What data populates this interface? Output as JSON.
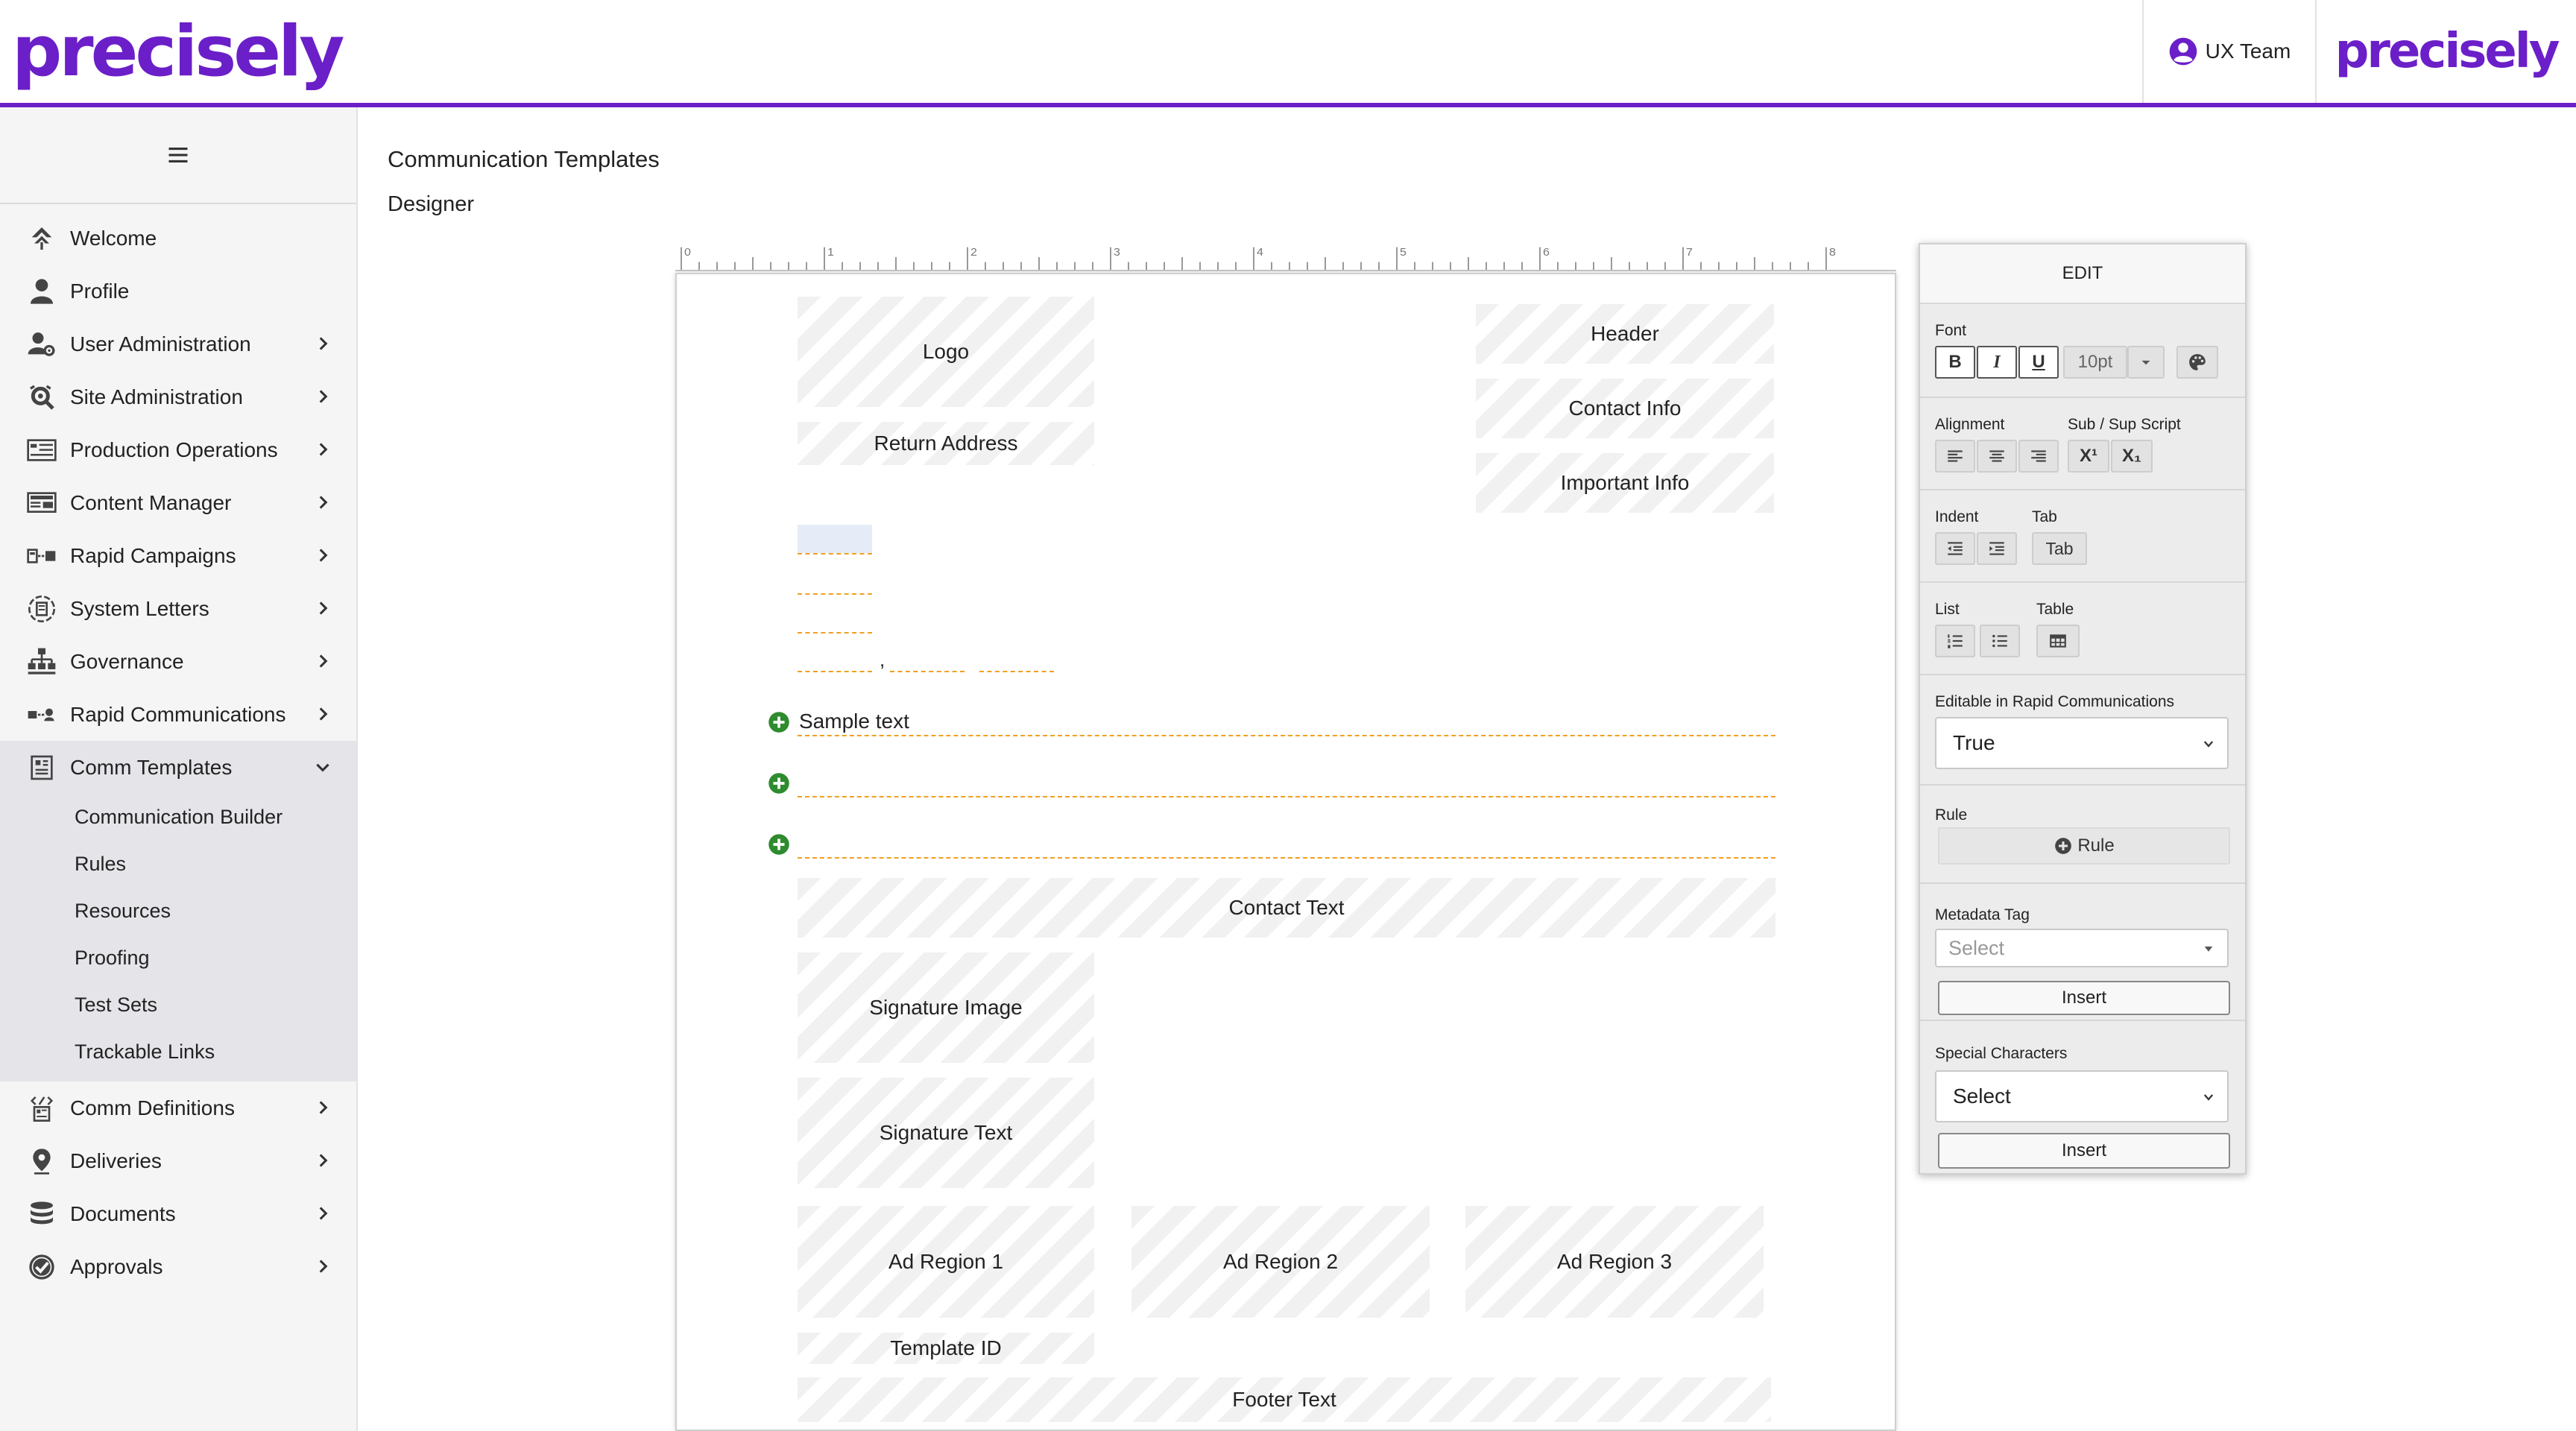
{
  "brand": {
    "name": "precisely",
    "logo_text": "precisely"
  },
  "header": {
    "user_label": "UX Team"
  },
  "sidebar": {
    "items": [
      {
        "label": "Welcome",
        "icon": "compass-icon",
        "chevron": false
      },
      {
        "label": "Profile",
        "icon": "person-icon",
        "chevron": false
      },
      {
        "label": "User Administration",
        "icon": "user-admin-icon",
        "chevron": true
      },
      {
        "label": "Site Administration",
        "icon": "site-gear-icon",
        "chevron": true
      },
      {
        "label": "Production Operations",
        "icon": "production-icon",
        "chevron": true
      },
      {
        "label": "Content Manager",
        "icon": "content-icon",
        "chevron": true
      },
      {
        "label": "Rapid Campaigns",
        "icon": "campaign-icon",
        "chevron": true
      },
      {
        "label": "System Letters",
        "icon": "letters-icon",
        "chevron": true
      },
      {
        "label": "Governance",
        "icon": "hierarchy-icon",
        "chevron": true
      },
      {
        "label": "Rapid Communications",
        "icon": "rapid-comm-icon",
        "chevron": true
      },
      {
        "label": "Comm Templates",
        "icon": "templates-icon",
        "chevron": true,
        "expanded": true
      }
    ],
    "sub_items": [
      "Communication Builder",
      "Rules",
      "Resources",
      "Proofing",
      "Test Sets",
      "Trackable Links"
    ],
    "items_after": [
      {
        "label": "Comm Definitions",
        "icon": "definitions-icon"
      },
      {
        "label": "Deliveries",
        "icon": "location-pin-icon"
      },
      {
        "label": "Documents",
        "icon": "stack-icon"
      },
      {
        "label": "Approvals",
        "icon": "check-badge-icon"
      }
    ]
  },
  "main": {
    "title": "Communication Templates",
    "subtitle": "Designer",
    "ruler_labels": [
      "0",
      "1",
      "2",
      "3",
      "4",
      "5",
      "6",
      "7",
      "8"
    ]
  },
  "canvas": {
    "logo": "Logo",
    "header": "Header",
    "return_address": "Return Address",
    "contact_info": "Contact Info",
    "important_info": "Important Info",
    "address_comma": ",",
    "sample_text": "Sample text",
    "contact_text": "Contact Text",
    "signature_image": "Signature Image",
    "signature_text": "Signature Text",
    "ad_region_1": "Ad Region 1",
    "ad_region_2": "Ad Region 2",
    "ad_region_3": "Ad Region 3",
    "template_id": "Template ID",
    "footer_text": "Footer Text"
  },
  "edit_panel": {
    "title": "EDIT",
    "font_label": "Font",
    "bold": "B",
    "italic": "I",
    "underline": "U",
    "font_size": "10pt",
    "alignment_label": "Alignment",
    "subsup_label": "Sub / Sup Script",
    "superscript": "X¹",
    "subscript": "X₁",
    "indent_label": "Indent",
    "tab_label": "Tab",
    "tab_button": "Tab",
    "list_label": "List",
    "table_label": "Table",
    "editable_label": "Editable in Rapid Communications",
    "editable_value": "True",
    "rule_label": "Rule",
    "rule_button": "Rule",
    "metadata_label": "Metadata Tag",
    "metadata_placeholder": "Select",
    "insert_1": "Insert",
    "special_label": "Special Characters",
    "special_value": "Select",
    "insert_2": "Insert"
  },
  "colors": {
    "brand": "#6b1fc8",
    "accent_add": "#2e8b2e",
    "dash": "#f0a020"
  }
}
